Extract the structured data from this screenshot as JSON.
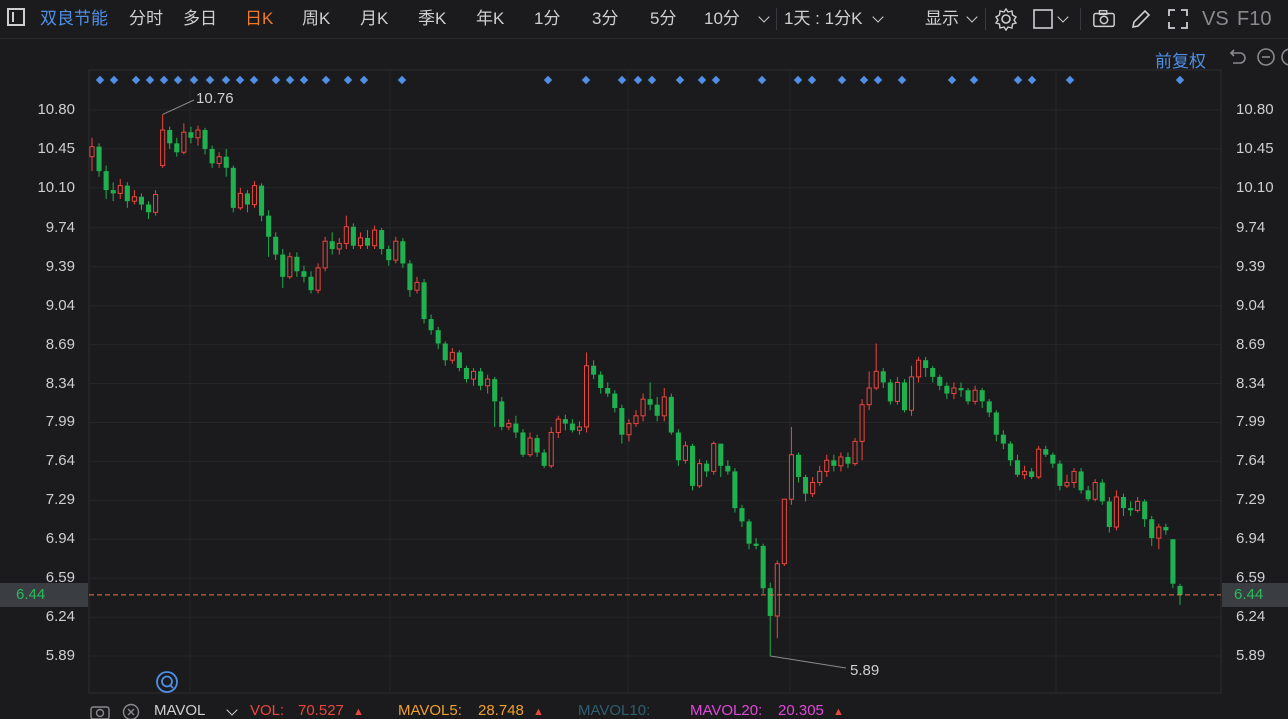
{
  "toolbar": {
    "stock_name": "双良节能",
    "tabs": [
      {
        "label": "分时"
      },
      {
        "label": "多日"
      },
      {
        "label": "日K"
      },
      {
        "label": "周K"
      },
      {
        "label": "月K"
      },
      {
        "label": "季K"
      },
      {
        "label": "年K"
      },
      {
        "label": "1分"
      },
      {
        "label": "3分"
      },
      {
        "label": "5分"
      },
      {
        "label": "10分"
      }
    ],
    "active_tab": "日K",
    "period_select": "1天 : 1分K",
    "display_label": "显示",
    "vs_label": "VS",
    "f10_label": "F10"
  },
  "chart_header": {
    "adjust_label": "前复权"
  },
  "axis": {
    "ticks": [
      "10.80",
      "10.45",
      "10.10",
      "9.74",
      "9.39",
      "9.04",
      "8.69",
      "8.34",
      "7.99",
      "7.64",
      "7.29",
      "6.94",
      "6.59",
      "6.24",
      "5.89"
    ]
  },
  "current_price": "6.44",
  "annotations": {
    "high": "10.76",
    "low": "5.89"
  },
  "indicator_bar": {
    "name": "MAVOL",
    "vol_label": "VOL:",
    "vol_value": "70.527",
    "mavol5_label": "MAVOL5:",
    "mavol5_value": "28.748",
    "mavol10_label": "MAVOL10:",
    "mavol20_label": "MAVOL20:",
    "mavol20_value": "20.305"
  },
  "colors": {
    "up": "#e9473f",
    "down": "#1fb04f",
    "accent": "#f07a2a",
    "link": "#4f8fe6",
    "price_line": "#e9744a"
  },
  "chart_data": {
    "type": "candlestick",
    "ylim": [
      5.89,
      10.8
    ],
    "candles": [
      [
        10.38,
        10.47,
        10.55,
        10.25
      ],
      [
        10.47,
        10.25,
        10.5,
        10.2
      ],
      [
        10.25,
        10.08,
        10.3,
        10.0
      ],
      [
        10.08,
        10.05,
        10.15,
        9.98
      ],
      [
        10.05,
        10.12,
        10.18,
        10.0
      ],
      [
        10.12,
        9.98,
        10.15,
        9.92
      ],
      [
        9.98,
        10.02,
        10.08,
        9.95
      ],
      [
        10.02,
        9.95,
        10.05,
        9.9
      ],
      [
        9.95,
        9.88,
        9.98,
        9.82
      ],
      [
        9.88,
        10.04,
        10.08,
        9.85
      ],
      [
        10.3,
        10.62,
        10.76,
        10.28
      ],
      [
        10.62,
        10.5,
        10.65,
        10.45
      ],
      [
        10.5,
        10.42,
        10.55,
        10.38
      ],
      [
        10.42,
        10.6,
        10.68,
        10.4
      ],
      [
        10.6,
        10.55,
        10.65,
        10.5
      ],
      [
        10.55,
        10.62,
        10.66,
        10.48
      ],
      [
        10.62,
        10.45,
        10.64,
        10.4
      ],
      [
        10.45,
        10.32,
        10.48,
        10.28
      ],
      [
        10.32,
        10.38,
        10.42,
        10.28
      ],
      [
        10.38,
        10.28,
        10.45,
        10.2
      ],
      [
        10.28,
        9.92,
        10.3,
        9.88
      ],
      [
        9.92,
        10.05,
        10.1,
        9.9
      ],
      [
        10.05,
        9.95,
        10.08,
        9.88
      ],
      [
        9.95,
        10.12,
        10.16,
        9.92
      ],
      [
        10.12,
        9.85,
        10.14,
        9.8
      ],
      [
        9.85,
        9.66,
        9.9,
        9.48
      ],
      [
        9.66,
        9.5,
        9.7,
        9.45
      ],
      [
        9.5,
        9.3,
        9.55,
        9.2
      ],
      [
        9.3,
        9.48,
        9.52,
        9.28
      ],
      [
        9.48,
        9.35,
        9.52,
        9.3
      ],
      [
        9.35,
        9.3,
        9.4,
        9.25
      ],
      [
        9.3,
        9.18,
        9.35,
        9.15
      ],
      [
        9.18,
        9.38,
        9.42,
        9.15
      ],
      [
        9.38,
        9.62,
        9.66,
        9.35
      ],
      [
        9.62,
        9.55,
        9.7,
        9.5
      ],
      [
        9.55,
        9.6,
        9.65,
        9.5
      ],
      [
        9.6,
        9.75,
        9.85,
        9.55
      ],
      [
        9.75,
        9.58,
        9.78,
        9.55
      ],
      [
        9.58,
        9.65,
        9.7,
        9.55
      ],
      [
        9.65,
        9.58,
        9.72,
        9.55
      ],
      [
        9.58,
        9.72,
        9.76,
        9.55
      ],
      [
        9.72,
        9.55,
        9.74,
        9.5
      ],
      [
        9.55,
        9.45,
        9.58,
        9.4
      ],
      [
        9.45,
        9.62,
        9.66,
        9.42
      ],
      [
        9.62,
        9.42,
        9.65,
        9.38
      ],
      [
        9.42,
        9.18,
        9.45,
        9.12
      ],
      [
        9.18,
        9.25,
        9.3,
        9.15
      ],
      [
        9.25,
        8.92,
        9.28,
        8.88
      ],
      [
        8.92,
        8.82,
        8.96,
        8.78
      ],
      [
        8.82,
        8.7,
        8.85,
        8.65
      ],
      [
        8.7,
        8.55,
        8.72,
        8.5
      ],
      [
        8.55,
        8.62,
        8.66,
        8.52
      ],
      [
        8.62,
        8.48,
        8.64,
        8.45
      ],
      [
        8.48,
        8.38,
        8.5,
        8.35
      ],
      [
        8.38,
        8.45,
        8.48,
        8.32
      ],
      [
        8.45,
        8.32,
        8.48,
        8.28
      ],
      [
        8.32,
        8.38,
        8.42,
        8.25
      ],
      [
        8.38,
        8.18,
        8.4,
        7.95
      ],
      [
        8.18,
        7.95,
        8.22,
        7.92
      ],
      [
        7.95,
        7.98,
        8.02,
        7.92
      ],
      [
        7.98,
        7.9,
        8.05,
        7.85
      ],
      [
        7.9,
        7.7,
        7.93,
        7.68
      ],
      [
        7.7,
        7.85,
        7.9,
        7.68
      ],
      [
        7.85,
        7.72,
        7.88,
        7.68
      ],
      [
        7.72,
        7.6,
        7.75,
        7.58
      ],
      [
        7.6,
        7.9,
        7.95,
        7.58
      ],
      [
        7.9,
        8.02,
        8.05,
        7.85
      ],
      [
        8.02,
        7.98,
        8.06,
        7.92
      ],
      [
        7.98,
        7.92,
        8.02,
        7.9
      ],
      [
        7.92,
        7.95,
        8.0,
        7.88
      ],
      [
        7.95,
        8.5,
        8.62,
        7.9
      ],
      [
        8.5,
        8.42,
        8.55,
        8.38
      ],
      [
        8.42,
        8.3,
        8.45,
        8.25
      ],
      [
        8.3,
        8.25,
        8.35,
        8.22
      ],
      [
        8.25,
        8.12,
        8.28,
        8.08
      ],
      [
        8.12,
        7.88,
        8.15,
        7.8
      ],
      [
        7.88,
        7.98,
        8.02,
        7.82
      ],
      [
        7.98,
        8.05,
        8.1,
        7.95
      ],
      [
        8.05,
        8.2,
        8.25,
        8.0
      ],
      [
        8.2,
        8.15,
        8.35,
        8.1
      ],
      [
        8.15,
        8.05,
        8.22,
        8.0
      ],
      [
        8.05,
        8.22,
        8.3,
        8.0
      ],
      [
        8.22,
        7.9,
        8.25,
        7.88
      ],
      [
        7.9,
        7.65,
        7.93,
        7.6
      ],
      [
        7.65,
        7.78,
        7.82,
        7.62
      ],
      [
        7.78,
        7.42,
        7.8,
        7.38
      ],
      [
        7.42,
        7.62,
        7.66,
        7.4
      ],
      [
        7.62,
        7.55,
        7.65,
        7.5
      ],
      [
        7.55,
        7.8,
        7.82,
        7.52
      ],
      [
        7.8,
        7.6,
        7.78,
        7.5
      ],
      [
        7.6,
        7.55,
        7.65,
        7.52
      ],
      [
        7.55,
        7.22,
        7.58,
        7.18
      ],
      [
        7.22,
        7.1,
        7.25,
        7.05
      ],
      [
        7.1,
        6.9,
        7.12,
        6.85
      ],
      [
        6.9,
        6.88,
        6.95,
        6.85
      ],
      [
        6.88,
        6.5,
        6.9,
        6.45
      ],
      [
        6.5,
        6.25,
        6.55,
        5.89
      ],
      [
        6.25,
        6.72,
        6.75,
        6.05
      ],
      [
        6.72,
        7.3,
        7.3,
        6.7
      ],
      [
        7.3,
        7.7,
        7.95,
        7.25
      ],
      [
        7.7,
        7.5,
        7.72,
        7.45
      ],
      [
        7.5,
        7.35,
        7.52,
        7.28
      ],
      [
        7.35,
        7.45,
        7.5,
        7.32
      ],
      [
        7.45,
        7.55,
        7.6,
        7.42
      ],
      [
        7.55,
        7.65,
        7.7,
        7.5
      ],
      [
        7.65,
        7.6,
        7.7,
        7.55
      ],
      [
        7.6,
        7.68,
        7.72,
        7.55
      ],
      [
        7.68,
        7.62,
        7.72,
        7.58
      ],
      [
        7.62,
        7.82,
        7.85,
        7.6
      ],
      [
        7.82,
        8.15,
        8.2,
        7.65
      ],
      [
        8.15,
        8.3,
        8.45,
        8.1
      ],
      [
        8.3,
        8.45,
        8.7,
        8.28
      ],
      [
        8.45,
        8.35,
        8.48,
        8.3
      ],
      [
        8.35,
        8.18,
        8.38,
        8.15
      ],
      [
        8.18,
        8.35,
        8.4,
        8.15
      ],
      [
        8.35,
        8.1,
        8.38,
        8.08
      ],
      [
        8.1,
        8.4,
        8.5,
        8.05
      ],
      [
        8.4,
        8.55,
        8.58,
        8.35
      ],
      [
        8.55,
        8.48,
        8.58,
        8.4
      ],
      [
        8.48,
        8.4,
        8.5,
        8.35
      ],
      [
        8.4,
        8.32,
        8.42,
        8.28
      ],
      [
        8.32,
        8.25,
        8.35,
        8.2
      ],
      [
        8.25,
        8.3,
        8.35,
        8.2
      ],
      [
        8.3,
        8.28,
        8.35,
        8.22
      ],
      [
        8.28,
        8.18,
        8.3,
        8.15
      ],
      [
        8.18,
        8.28,
        8.32,
        8.15
      ],
      [
        8.28,
        8.18,
        8.3,
        8.12
      ],
      [
        8.18,
        8.08,
        8.2,
        8.04
      ],
      [
        8.08,
        7.88,
        8.1,
        7.82
      ],
      [
        7.88,
        7.8,
        7.92,
        7.75
      ],
      [
        7.8,
        7.65,
        7.82,
        7.6
      ],
      [
        7.65,
        7.52,
        7.7,
        7.5
      ],
      [
        7.52,
        7.55,
        7.6,
        7.48
      ],
      [
        7.55,
        7.5,
        7.58,
        7.48
      ],
      [
        7.5,
        7.75,
        7.78,
        7.48
      ],
      [
        7.75,
        7.7,
        7.78,
        7.68
      ],
      [
        7.7,
        7.62,
        7.72,
        7.58
      ],
      [
        7.62,
        7.42,
        7.65,
        7.38
      ],
      [
        7.42,
        7.45,
        7.52,
        7.4
      ],
      [
        7.45,
        7.55,
        7.58,
        7.4
      ],
      [
        7.55,
        7.38,
        7.58,
        7.35
      ],
      [
        7.38,
        7.3,
        7.42,
        7.28
      ],
      [
        7.3,
        7.45,
        7.48,
        7.28
      ],
      [
        7.45,
        7.28,
        7.48,
        7.25
      ],
      [
        7.28,
        7.05,
        7.32,
        7.0
      ],
      [
        7.05,
        7.32,
        7.38,
        7.02
      ],
      [
        7.32,
        7.22,
        7.35,
        7.15
      ],
      [
        7.22,
        7.2,
        7.28,
        7.15
      ],
      [
        7.2,
        7.28,
        7.32,
        7.18
      ],
      [
        7.28,
        7.12,
        7.3,
        7.05
      ],
      [
        7.12,
        6.95,
        7.15,
        6.88
      ],
      [
        6.95,
        7.05,
        7.08,
        6.85
      ],
      [
        7.05,
        7.02,
        7.08,
        6.98
      ],
      [
        6.94,
        6.54,
        6.94,
        6.5
      ],
      [
        6.52,
        6.44,
        6.54,
        6.35
      ]
    ]
  }
}
